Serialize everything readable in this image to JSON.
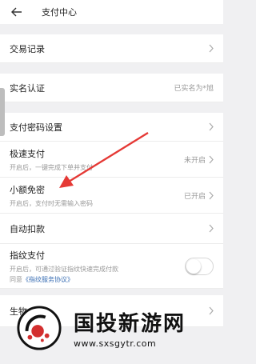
{
  "header": {
    "title": "支付中心"
  },
  "rows": [
    {
      "label": "交易记录"
    },
    {
      "label": "实名认证",
      "value": "已实名为*旭"
    },
    {
      "label": "支付密码设置"
    },
    {
      "label": "极速支付",
      "sub": "开启后，一键完成下单并支付",
      "value": "未开启"
    },
    {
      "label": "小额免密",
      "sub": "开启后，支付时无需输入密码",
      "value": "已开启"
    },
    {
      "label": "自动扣款"
    },
    {
      "label": "指纹支付",
      "sub": "开启后，可通过验证指纹快速完成付款",
      "sub2_prefix": "同意",
      "sub2_link": "《指纹服务协议》"
    },
    {
      "label": "生物"
    }
  ],
  "watermark": {
    "main": "国投新游网",
    "url": "www.sxsgytr.com"
  },
  "colors": {
    "arrow": "#e53935",
    "link": "#3b6fb4",
    "background": "#f0f0f2"
  }
}
